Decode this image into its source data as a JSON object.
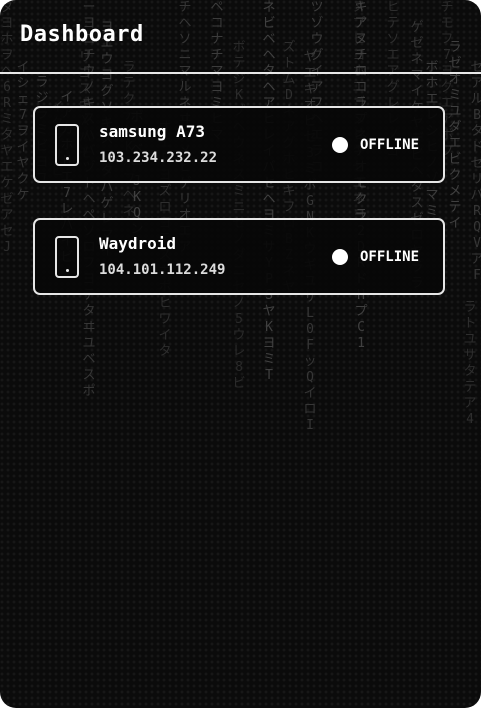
{
  "header": {
    "title": "Dashboard"
  },
  "devices": [
    {
      "name": "samsung A73",
      "ip": "103.234.232.22",
      "status": "OFFLINE",
      "status_color": "#ffffff"
    },
    {
      "name": "Waydroid",
      "ip": "104.101.112.249",
      "status": "OFFLINE",
      "status_color": "#ffffff"
    }
  ],
  "icons": {
    "device": "phone-icon",
    "status": "status-dot-icon"
  },
  "background": {
    "rain_columns": [
      "ダヨホヲヘ6RミタヤエケゼアセJ",
      "イシェ7ヲイヤクケ",
      "ラジラミビヨユ",
      "イクアサヒ",
      "イアカホHエ7レバイビ",
      "リゴスキXハモ",
      "ーヨコチウノキスハバヅトヘペソロフヨテタヰユベスポ",
      "ヨエウヨグソキスマタパゲレマイ",
      "ラテクテケKホフヘネ",
      "ポカベーJKQンネ",
      "オエFヨズロヨテスポポヒワイタ",
      "チヘソニマルネヰケメヒゲリオエア",
      "ペコナチマヨミヒマ",
      "ボテジKブヘウネスミニセノダニセノ5ウレ8ビ",
      "ネビベヘタヘアヒレイバセヘヨミサYPSヤKヨミT",
      "ズトムDネアグホヒキフロBZネヤ",
      "ヤエキオビセ3ミボGNKウギユサL0FッQイロI",
      "ツゾウグイアフヘエラコ",
      "ヌプヒヨホエゴヌヒキセエネヨ",
      "キアヌチロコラプネアオモクラ2DRドHプC1",
      "ヒテソエアグレレノゴ",
      "ゲゼネマイケヤデビヘタスゼロヤララ",
      "ボホエレシヒノゾマミ",
      "チモフ7ヨグエアボフ",
      "ラゼオミユダエビクメテイ",
      "ラトユサタテア4",
      "セアルBタドセリパRQVアF"
    ]
  }
}
